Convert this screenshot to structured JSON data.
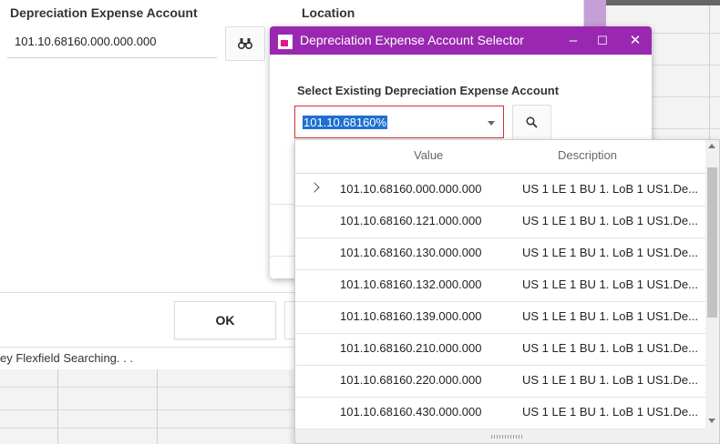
{
  "main": {
    "depreciation_label": "Depreciation Expense Account",
    "location_label": "Location",
    "account_value": "101.10.68160.000.000.000",
    "ok_label": "OK",
    "status_text": "ey Flexfield Searching. . ."
  },
  "dialog": {
    "title": "Depreciation Expense Account Selector",
    "minimize": "–",
    "maximize": "☐",
    "close": "✕",
    "select_label": "Select Existing Depreciation Expense Account",
    "combo_value": "101.10.68160%"
  },
  "dropdown": {
    "columns": {
      "value": "Value",
      "description": "Description"
    },
    "rows": [
      {
        "value": "101.10.68160.000.000.000",
        "description": "US 1 LE 1 BU 1. LoB 1 US1.De..."
      },
      {
        "value": "101.10.68160.121.000.000",
        "description": "US 1 LE 1 BU 1. LoB 1 US1.De..."
      },
      {
        "value": "101.10.68160.130.000.000",
        "description": "US 1 LE 1 BU 1. LoB 1 US1.De..."
      },
      {
        "value": "101.10.68160.132.000.000",
        "description": "US 1 LE 1 BU 1. LoB 1 US1.De..."
      },
      {
        "value": "101.10.68160.139.000.000",
        "description": "US 1 LE 1 BU 1. LoB 1 US1.De..."
      },
      {
        "value": "101.10.68160.210.000.000",
        "description": "US 1 LE 1 BU 1. LoB 1 US1.De..."
      },
      {
        "value": "101.10.68160.220.000.000",
        "description": "US 1 LE 1 BU 1. LoB 1 US1.De..."
      },
      {
        "value": "101.10.68160.430.000.000",
        "description": "US 1 LE 1 BU 1. LoB 1 US1.De..."
      }
    ]
  },
  "colors": {
    "dialog_title_bar": "#9a27b0",
    "combo_border": "#d0303a",
    "selection": "#1f6fd0"
  }
}
